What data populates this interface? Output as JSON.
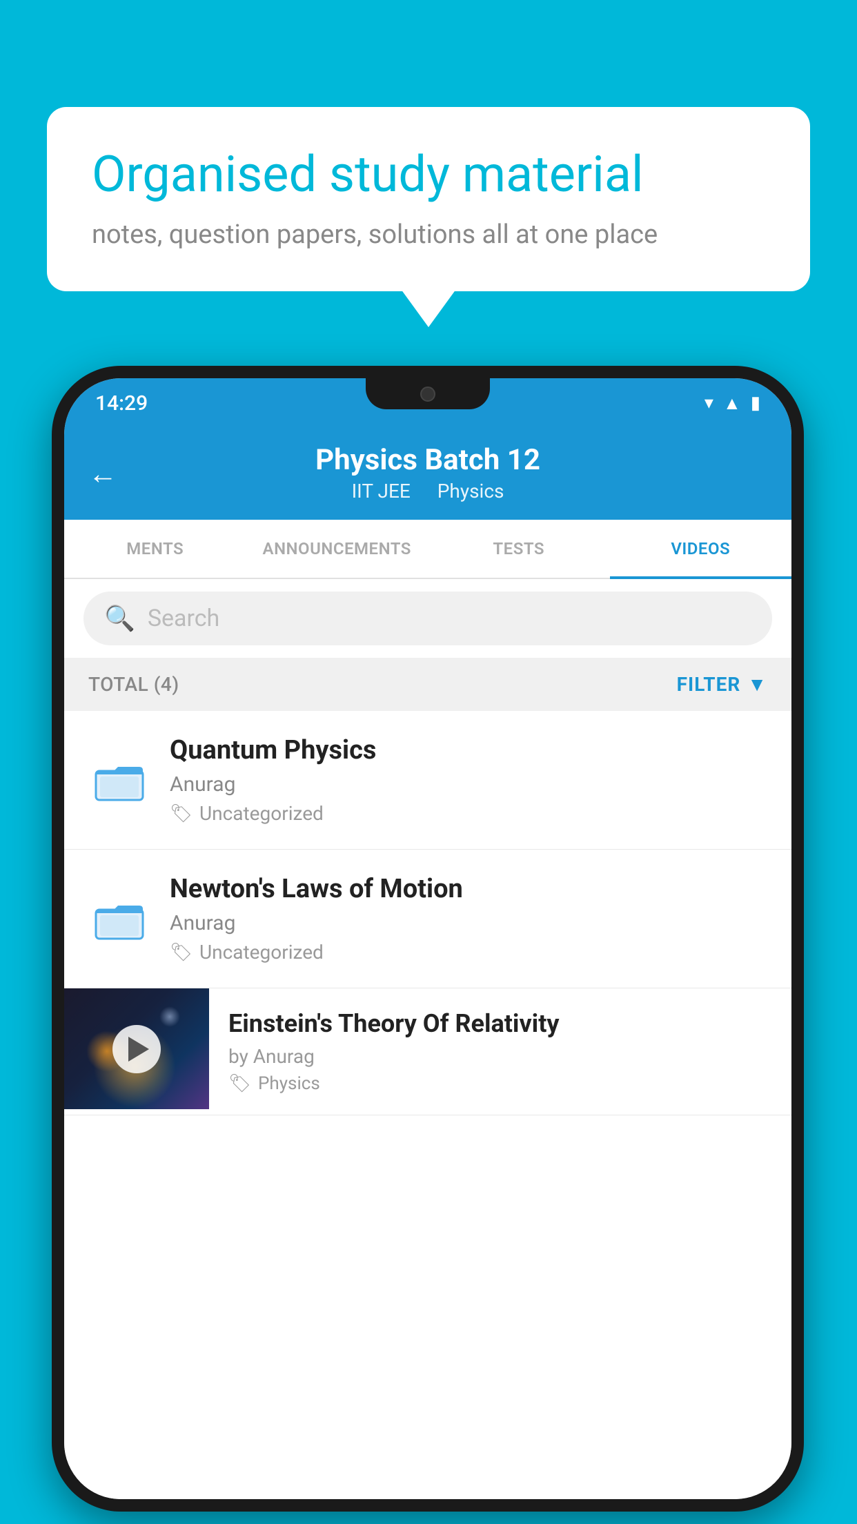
{
  "background_color": "#00b8d9",
  "speech_bubble": {
    "title": "Organised study material",
    "subtitle": "notes, question papers, solutions all at one place"
  },
  "status_bar": {
    "time": "14:29",
    "icons": [
      "wifi",
      "signal",
      "battery"
    ]
  },
  "app_header": {
    "back_label": "←",
    "title": "Physics Batch 12",
    "subtitle_part1": "IIT JEE",
    "subtitle_part2": "Physics"
  },
  "tabs": [
    {
      "label": "MENTS",
      "active": false
    },
    {
      "label": "ANNOUNCEMENTS",
      "active": false
    },
    {
      "label": "TESTS",
      "active": false
    },
    {
      "label": "VIDEOS",
      "active": true
    }
  ],
  "search": {
    "placeholder": "Search"
  },
  "filter_bar": {
    "total_label": "TOTAL (4)",
    "filter_label": "FILTER"
  },
  "videos": [
    {
      "title": "Quantum Physics",
      "author": "Anurag",
      "category": "Uncategorized",
      "has_thumbnail": false
    },
    {
      "title": "Newton's Laws of Motion",
      "author": "Anurag",
      "category": "Uncategorized",
      "has_thumbnail": false
    },
    {
      "title": "Einstein's Theory Of Relativity",
      "author": "by Anurag",
      "category": "Physics",
      "has_thumbnail": true
    }
  ]
}
